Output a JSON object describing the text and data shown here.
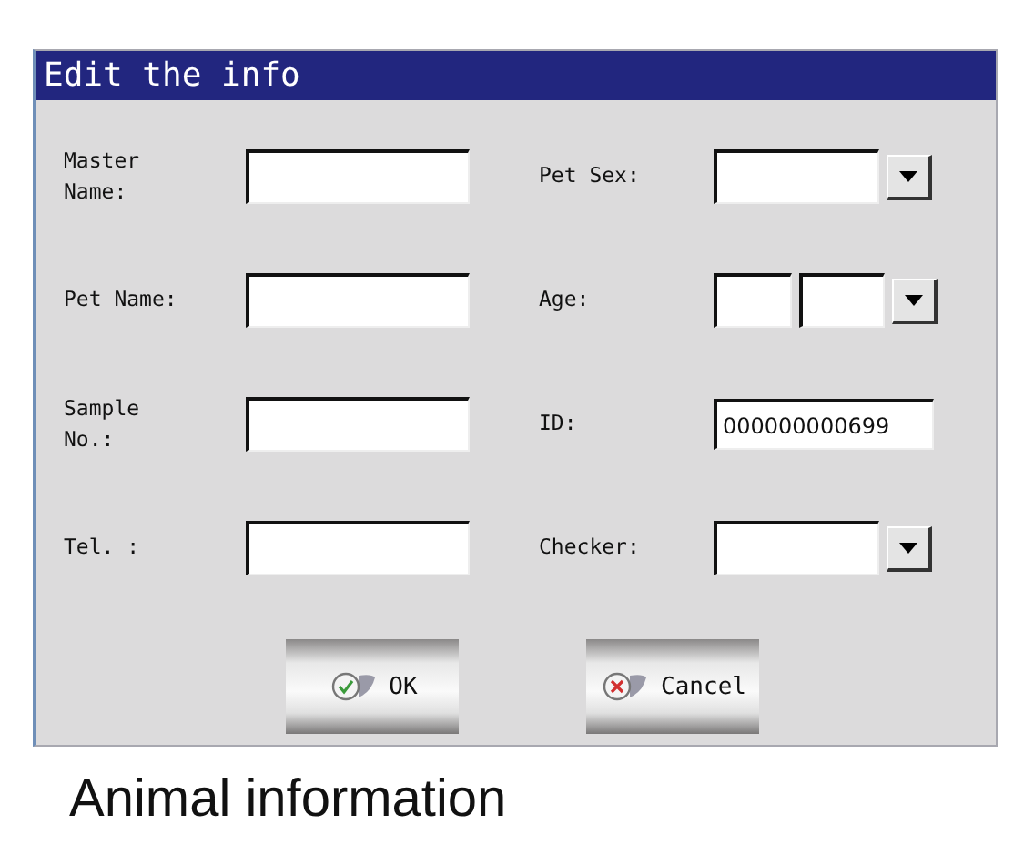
{
  "window": {
    "title": "Edit the info"
  },
  "left_fields": [
    {
      "label": "Master\nName:"
    },
    {
      "label": "Pet Name:"
    },
    {
      "label": "Sample\nNo.:"
    },
    {
      "label": "Tel. :"
    }
  ],
  "right_fields": [
    {
      "label": "Pet Sex:",
      "kind": "dropdown"
    },
    {
      "label": "Age:",
      "kind": "age"
    },
    {
      "label": "ID:",
      "kind": "text",
      "value": "000000000699"
    },
    {
      "label": "Checker:",
      "kind": "dropdown"
    }
  ],
  "buttons": [
    {
      "label": "OK",
      "kind": "ok"
    },
    {
      "label": "Cancel",
      "kind": "cancel"
    }
  ],
  "caption": "Animal information"
}
